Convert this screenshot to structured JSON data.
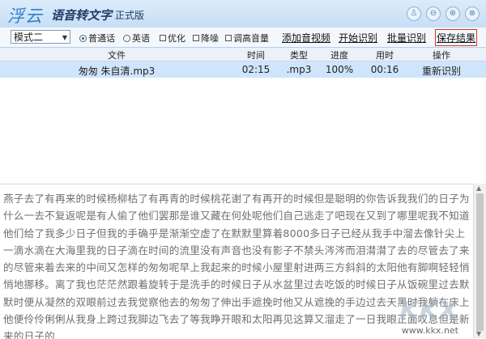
{
  "titlebar": {
    "logo": "浮云",
    "title": "语音转文字",
    "edition": "正式版",
    "buttons": {
      "user": "♙",
      "minimize": "⊖",
      "restore": "⊕",
      "close": "⊗"
    }
  },
  "toolbar": {
    "mode_select": "模式二",
    "radio_mandarin": "普通话",
    "radio_english": "英语",
    "check_optimize": "优化",
    "check_denoise": "降噪",
    "check_volume": "调高音量",
    "add_video": "添加音视频",
    "start": "开始识别",
    "batch": "批量识别",
    "save": "保存结果"
  },
  "table": {
    "headers": [
      "文件",
      "时间",
      "类型",
      "进度",
      "用时",
      "操作"
    ],
    "rows": [
      {
        "file": "匆匆 朱自清.mp3",
        "time": "02:15",
        "type": ".mp3",
        "progress": "100%",
        "elapsed": "00:16",
        "action": "重新识别"
      }
    ]
  },
  "result_text": "燕子去了有再来的时候杨柳枯了有再青的时候桃花谢了有再开的时候但是聪明的你告诉我我们的日子为什么一去不复返呢是有人偷了他们罢那是谁又藏在何处呢他们自己逃走了吧现在又到了哪里呢我不知道他们给了我多少日子但我的手确乎是渐渐空虚了在默默里算着8000多日子已经从我手中溜去像针尖上一滴水滴在大海里我的日子滴在时间的流里没有声音也没有影子不禁头涔涔而泪潸潸了去的尽管去了来的尽管来着去来的中间又怎样的匆匆呢早上我起来的时候小屋里射进两三方斜斜的太阳他有脚啊轻轻悄悄地挪移。离了我也茫茫然跟着旋转于是洗手的时候日子从水盆里过去吃饭的时候日子从饭碗里过去默默时便从凝然的双眼前过去我觉察他去的匆匆了伸出手遮挽时他又从遮挽的手边过去天黑时我躺在床上他便伶伶俐俐从我身上跨过我脚边飞去了等我睁开眼和太阳再见这算又溜走了一日我眼正面叹息但是新来的日子的",
  "watermark": {
    "logo": "KKX",
    "url": "www.kkx.net"
  },
  "colors": {
    "accent": "#2f7fcf",
    "selected_row": "#cfe5fb",
    "highlight_box": "#d9332b"
  }
}
